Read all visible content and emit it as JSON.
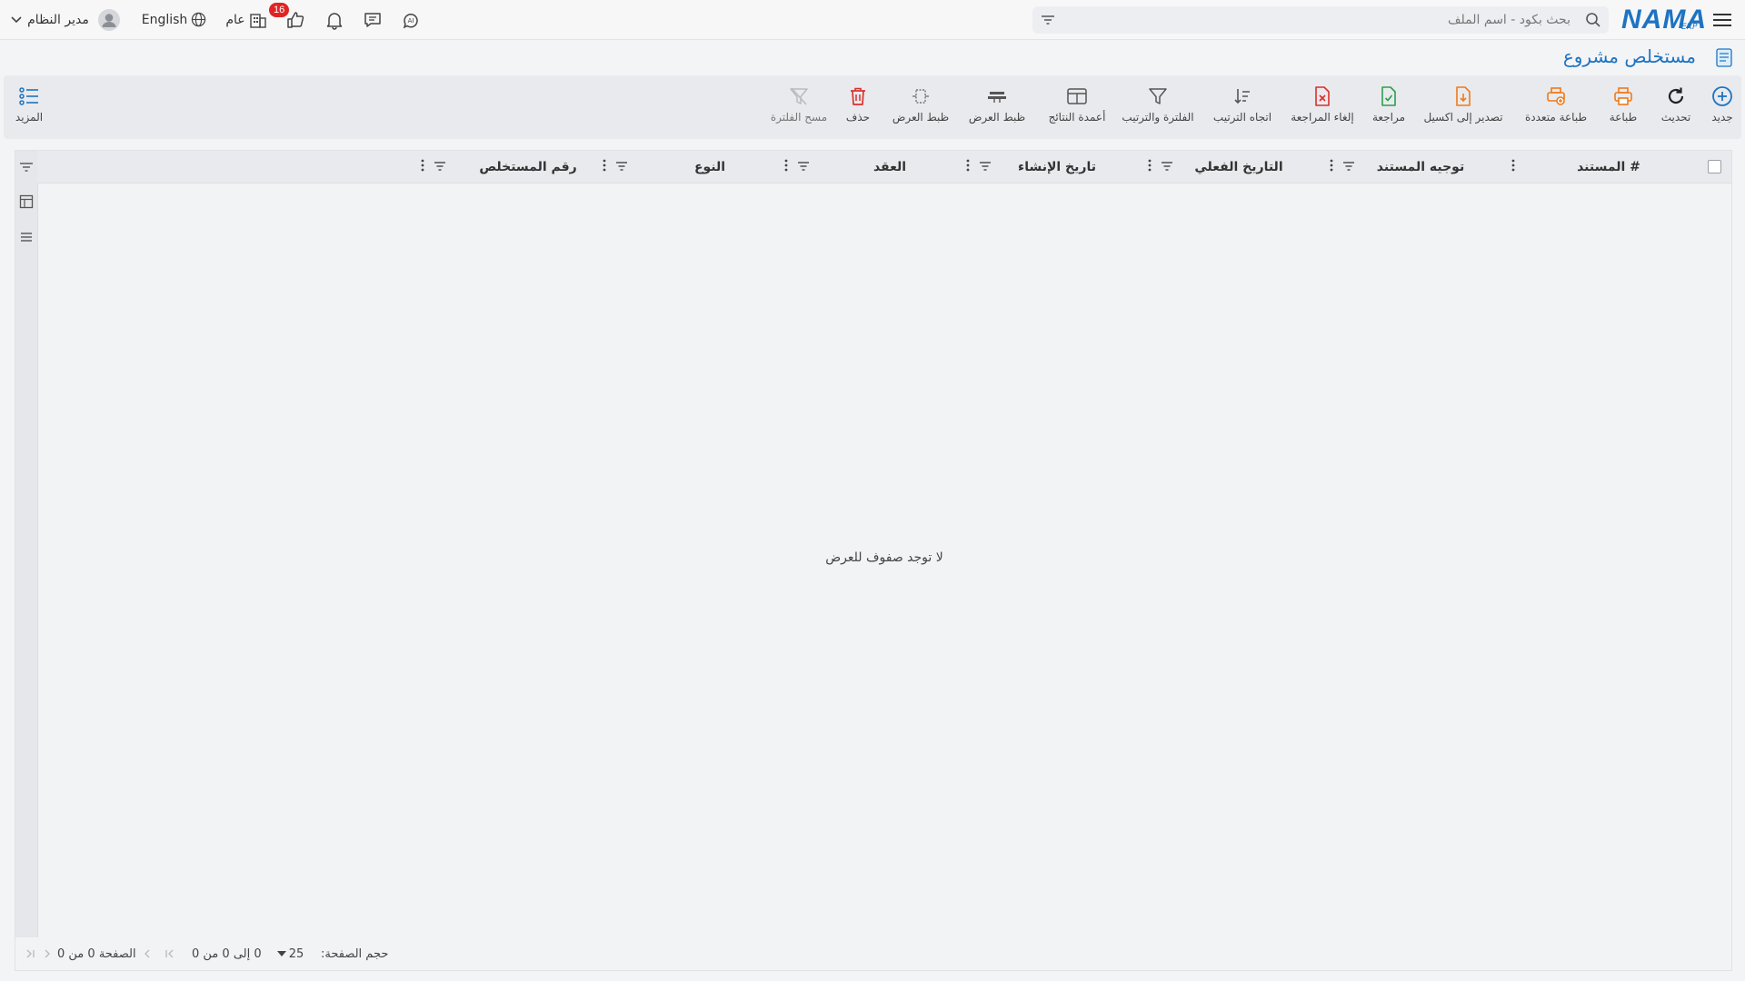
{
  "app": {
    "logo_text": "NAMA",
    "logo_sub": "ERP"
  },
  "search": {
    "placeholder": "بحث بكود - اسم الملف"
  },
  "topbar": {
    "notification_count": "16",
    "scope_label": "عام",
    "language_label": "English",
    "user_name": "مدير النظام"
  },
  "page": {
    "title": "مستخلص مشروع"
  },
  "toolbar": {
    "new": "جديد",
    "refresh": "تحديث",
    "print": "طباعة",
    "multi_print": "طباعة متعددة",
    "export_excel": "تصدير إلى اكسيل",
    "review": "مراجعة",
    "cancel_review": "إلغاء المراجعة",
    "sort_direction": "اتجاه الترتيب",
    "filter_sort": "الفلترة والترتيب",
    "result_columns": "أعمدة النتائج",
    "fit_width_1": "ظبط العرض",
    "fit_width_2": "ظبط العرض",
    "delete": "حذف",
    "clear_filter": "مسح الفلترة",
    "more": "المزيد"
  },
  "grid": {
    "columns": [
      "# المستند",
      "توجيه المستند",
      "التاريخ الفعلي",
      "تاريخ الإنشاء",
      "العقد",
      "النوع",
      "رقم المستخلص"
    ],
    "empty_message": "لا توجد صفوف للعرض"
  },
  "footer": {
    "page_size_label": "حجم الصفحة:",
    "page_size_value": "25",
    "range_text": "0 إلى 0 من 0",
    "page_text": "الصفحة 0 من 0"
  },
  "colors": {
    "accent": "#1d73c2",
    "danger": "#d9302c",
    "success": "#2e9e4f",
    "warning": "#f07a1a"
  }
}
